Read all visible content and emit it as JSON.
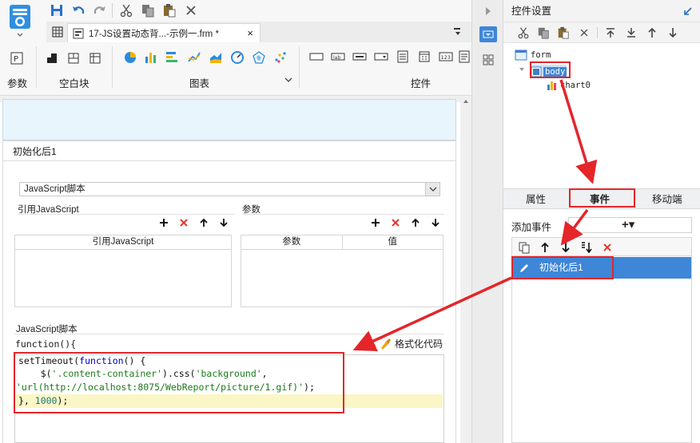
{
  "file_tab": {
    "title": "17-JS设置动态背...-示例一.frm *",
    "close": "×"
  },
  "ribbon": {
    "group_params": "参数",
    "group_blank": "空白块",
    "group_chart": "图表",
    "group_widget": "控件"
  },
  "editor": {
    "event_name": "初始化后1",
    "script_type": "JavaScript脚本",
    "ref_js_label": "引用JavaScript",
    "params_label": "参数",
    "ref_js_col": "引用JavaScript",
    "param_col": "参数",
    "value_col": "值",
    "script_label": "JavaScript脚本",
    "func_header": "function(){",
    "format_code": "格式化代码",
    "code": {
      "line1_a": "setTimeout(",
      "line1_b": "function",
      "line1_c": "() {",
      "line2_a": "    $(",
      "line2_b": "'.content-container'",
      "line2_c": ").css(",
      "line2_d": "'background'",
      "line2_e": ",",
      "line3_a": "'url(http://localhost:8075/WebReport/picture/1.gif)'",
      "line3_b": ");",
      "line4_a": "}, ",
      "line4_b": "1000",
      "line4_c": ");"
    }
  },
  "right_panel": {
    "title": "控件设置",
    "tree": {
      "root": "form",
      "body": "body",
      "chart": "chart0"
    },
    "tabs": {
      "properties": "属性",
      "events": "事件",
      "mobile": "移动端"
    },
    "add_event_label": "添加事件",
    "add_event_combo": "+▾",
    "events": [
      {
        "name": "初始化后1"
      }
    ]
  },
  "colors": {
    "accent": "#3e86d8",
    "annotation": "#e4252a",
    "highlight": "#fbf6c5"
  }
}
